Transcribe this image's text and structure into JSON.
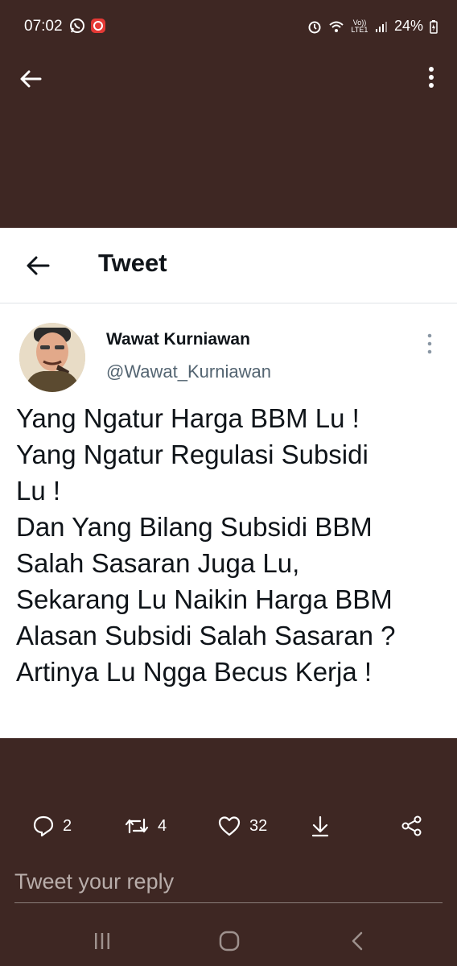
{
  "status_bar": {
    "time": "07:02",
    "battery": "24%",
    "network_badge": "Vo)) LTE1"
  },
  "tweet_header": {
    "title": "Tweet"
  },
  "tweet": {
    "author_name": "Wawat Kurniawan",
    "author_handle": "@Wawat_Kurniawan",
    "lines": [
      "Yang Ngatur Harga BBM Lu !",
      "Yang Ngatur Regulasi Subsidi",
      "Lu !",
      "Dan Yang Bilang Subsidi BBM",
      "Salah Sasaran Juga Lu,",
      "Sekarang Lu Naikin Harga BBM",
      "Alasan Subsidi Salah Sasaran ?",
      "Artinya Lu Ngga Becus Kerja !"
    ]
  },
  "actions": {
    "reply_count": "2",
    "retweet_count": "4",
    "like_count": "32"
  },
  "reply": {
    "placeholder": "Tweet your reply"
  },
  "icons": {
    "back": "arrow-left-icon",
    "more": "more-vertical-icon",
    "reply": "comment-icon",
    "retweet": "retweet-icon",
    "like": "heart-icon",
    "bookmark": "download-arrow-icon",
    "share": "share-icon"
  },
  "colors": {
    "background": "#3e2723",
    "card": "#ffffff",
    "text": "#0f1419",
    "secondary_text": "#536471"
  }
}
